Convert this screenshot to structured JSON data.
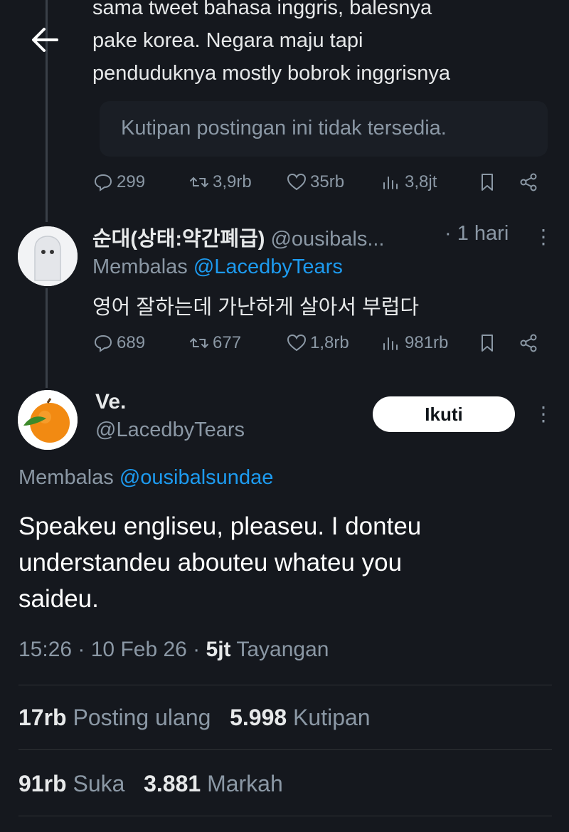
{
  "nav": {
    "back_icon": "arrow-left-icon"
  },
  "parent_tweet": {
    "text_lines": [
      "sama tweet bahasa inggris, balesnya",
      "pake korea. Negara maju tapi",
      "penduduknya mostly bobrok inggrisnya"
    ],
    "quote_unavailable": "Kutipan postingan ini tidak tersedia.",
    "replies": "299",
    "reposts": "3,9rb",
    "likes": "35rb",
    "views": "3,8jt"
  },
  "reply_tweet": {
    "display_name": "순대(상태:약간폐급)",
    "handle": "@ousibals...",
    "time": "· 1 hari",
    "replying_label": "Membalas",
    "replying_to": "@LacedbyTears",
    "text": "영어 잘하는데 가난하게 살아서 부럽다",
    "replies": "689",
    "reposts": "677",
    "likes": "1,8rb",
    "views": "981rb"
  },
  "main_tweet": {
    "display_name": "Ve.",
    "handle": "@LacedbyTears",
    "follow_label": "Ikuti",
    "replying_label": "Membalas",
    "replying_to": "@ousibalsundae",
    "text_lines": [
      "Speakeu engliseu, pleaseu. I donteu",
      "understandeu abouteu whateu you",
      "saideu."
    ],
    "time": "15:26 · 10 Feb 26 ·",
    "views_count": "5jt",
    "views_label": "Tayangan",
    "reposts_count": "17rb",
    "reposts_label": "Posting ulang",
    "quotes_count": "5.998",
    "quotes_label": "Kutipan",
    "likes_count": "91rb",
    "likes_label": "Suka",
    "bookmarks_count": "3.881",
    "bookmarks_label": "Markah"
  },
  "colors": {
    "background": "#15181e",
    "link": "#1d9bf0",
    "muted": "#8b98a5"
  }
}
